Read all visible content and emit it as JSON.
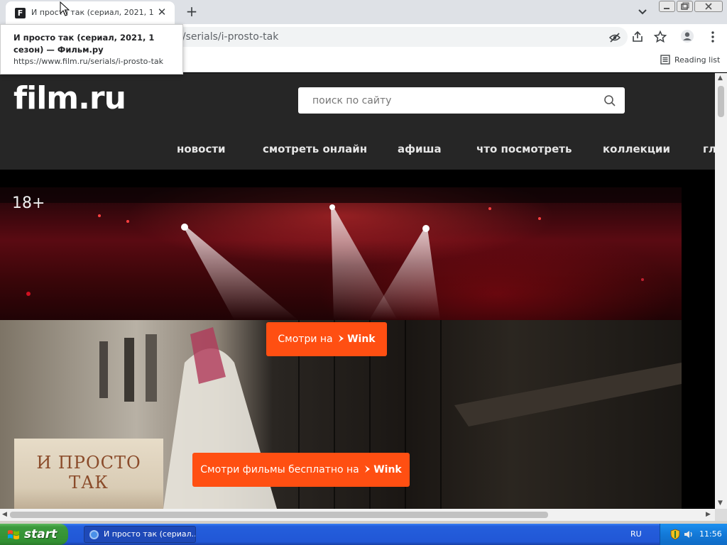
{
  "browser": {
    "tab_favicon_letter": "F",
    "tab_title": "И просто так (сериал, 2021, 1 сезон) — Фильм.ру",
    "tab_close": "✕",
    "new_tab": "+",
    "url_visible": "u/serials/i-prosto-tak",
    "reading_list_label": "Reading list"
  },
  "tooltip": {
    "title": "И просто так (сериал, 2021, 1 сезон) — Фильм.ру",
    "url": "https://www.film.ru/serials/i-prosto-tak"
  },
  "site": {
    "logo": "film.ru",
    "search_placeholder": "поиск по сайту",
    "nav": [
      "новости",
      "смотреть онлайн",
      "афиша",
      "что посмотреть",
      "коллекции",
      "гл"
    ],
    "age_rating": "18+",
    "cta_primary_text": "Смотри на",
    "cta_secondary_text": "Смотри фильмы бесплатно на",
    "cta_brand": "Wink",
    "poster_title": "И ПРОСТО ТАК",
    "accent_color": "#ff4f12",
    "header_color": "#262626"
  },
  "taskbar": {
    "start_label": "start",
    "task_label": "И просто так (сериал...",
    "language": "RU",
    "clock": "11:56"
  }
}
